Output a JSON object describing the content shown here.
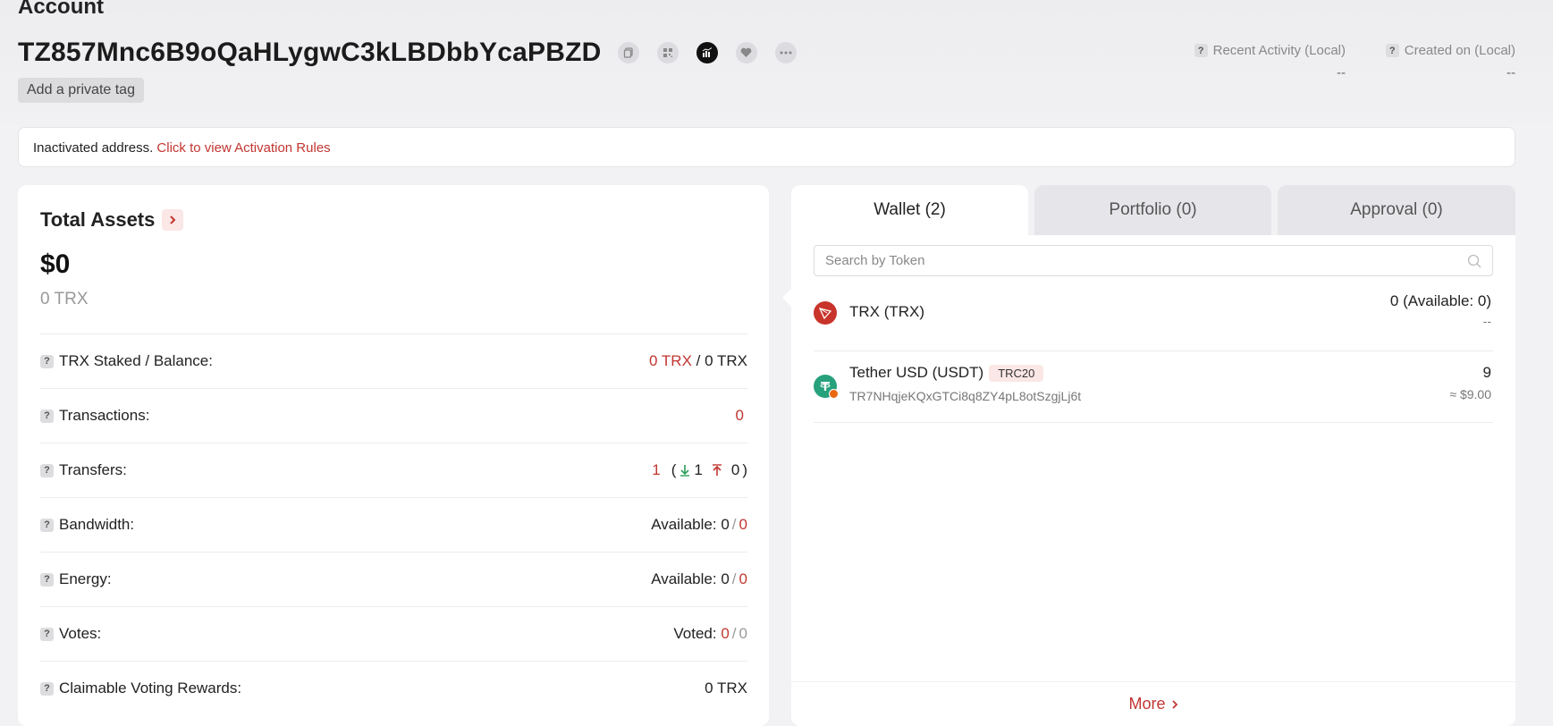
{
  "header": {
    "heading": "Account",
    "address": "TZ857Mnc6B9oQaHLygwC3kLBDbbYcaPBZD",
    "private_tag_label": "Add a private tag",
    "icons": [
      "copy-icon",
      "qr-code-icon",
      "analytics-icon",
      "heart-icon",
      "more-icon"
    ],
    "recent_activity_label": "Recent Activity (Local)",
    "recent_activity_value": "--",
    "created_on_label": "Created on (Local)",
    "created_on_value": "--"
  },
  "notice": {
    "text": "Inactivated address.",
    "link": "Click to view Activation Rules"
  },
  "assets": {
    "title": "Total Assets",
    "usd_total": "$0",
    "trx_total": "0 TRX",
    "rows": {
      "staked": {
        "label": "TRX Staked / Balance:",
        "staked": "0 TRX",
        "sep": "/",
        "balance": "0 TRX"
      },
      "transactions": {
        "label": "Transactions:",
        "value": "0"
      },
      "transfers": {
        "label": "Transfers:",
        "total": "1",
        "open": "(",
        "in": "1",
        "out": "0",
        "close": ")"
      },
      "bandwidth": {
        "label": "Bandwidth:",
        "prefix": "Available:",
        "available": "0",
        "sep": "/",
        "total": "0"
      },
      "energy": {
        "label": "Energy:",
        "prefix": "Available:",
        "available": "0",
        "sep": "/",
        "total": "0"
      },
      "votes": {
        "label": "Votes:",
        "prefix": "Voted:",
        "voted": "0",
        "sep": "/",
        "total": "0"
      },
      "rewards": {
        "label": "Claimable Voting Rewards:",
        "value": "0 TRX"
      }
    }
  },
  "wallet": {
    "tabs": [
      "Wallet (2)",
      "Portfolio (0)",
      "Approval (0)"
    ],
    "active_tab": 0,
    "search_placeholder": "Search by Token",
    "tokens": [
      {
        "name": "TRX (TRX)",
        "amount": "0 (Available: 0)",
        "value": "--",
        "icon": "trx-logo-icon"
      },
      {
        "name": "Tether USD (USDT)",
        "badge": "TRC20",
        "contract": "TR7NHqjeKQxGTCi8q8ZY4pL8otSzgjLj6t",
        "amount": "9",
        "value": "≈ $9.00",
        "icon": "usdt-logo-icon"
      }
    ],
    "more_label": "More"
  },
  "colors": {
    "accent": "#c23631",
    "green": "#2aa05a",
    "tether": "#26a17b"
  }
}
